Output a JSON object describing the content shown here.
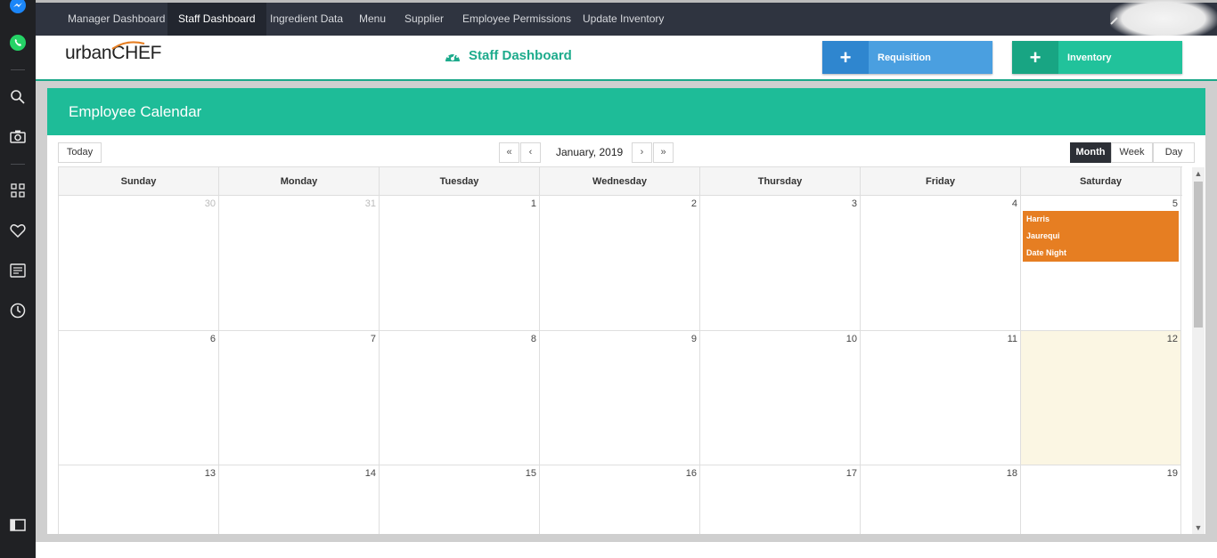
{
  "nav": {
    "items": [
      "Manager Dashboard",
      "Staff Dashboard",
      "Ingredient Data",
      "Menu",
      "Supplier",
      "Employee Permissions",
      "Update Inventory"
    ],
    "active": "Staff Dashboard"
  },
  "header": {
    "logo_prefix": "urban",
    "logo_suffix": "CHEF",
    "title": "Staff Dashboard",
    "requisition_label": "Requisition",
    "inventory_label": "Inventory"
  },
  "panel": {
    "title": "Employee Calendar"
  },
  "toolbar": {
    "today_label": "Today",
    "first_label": "«",
    "prev_label": "‹",
    "next_label": "›",
    "last_label": "»",
    "current_date": "January, 2019",
    "views": [
      "Month",
      "Week",
      "Day"
    ],
    "active_view": "Month"
  },
  "calendar": {
    "weekdays": [
      "Sunday",
      "Monday",
      "Tuesday",
      "Wednesday",
      "Thursday",
      "Friday",
      "Saturday"
    ],
    "weeks": [
      [
        "30",
        "31",
        "1",
        "2",
        "3",
        "4",
        "5"
      ],
      [
        "6",
        "7",
        "8",
        "9",
        "10",
        "11",
        "12"
      ],
      [
        "13",
        "14",
        "15",
        "16",
        "17",
        "18",
        "19"
      ]
    ],
    "muted_days": [
      "30",
      "31"
    ],
    "today": "12",
    "event_day": "5",
    "event_lines": [
      "Harris",
      "Jaurequi",
      "Date Night"
    ]
  },
  "colors": {
    "nav_bg": "#2f3440",
    "accent": "#1ebc98",
    "requisition": "#4a9fe0",
    "inventory": "#21c29b",
    "event": "#e67e22",
    "today_bg": "#fbf6e3"
  }
}
